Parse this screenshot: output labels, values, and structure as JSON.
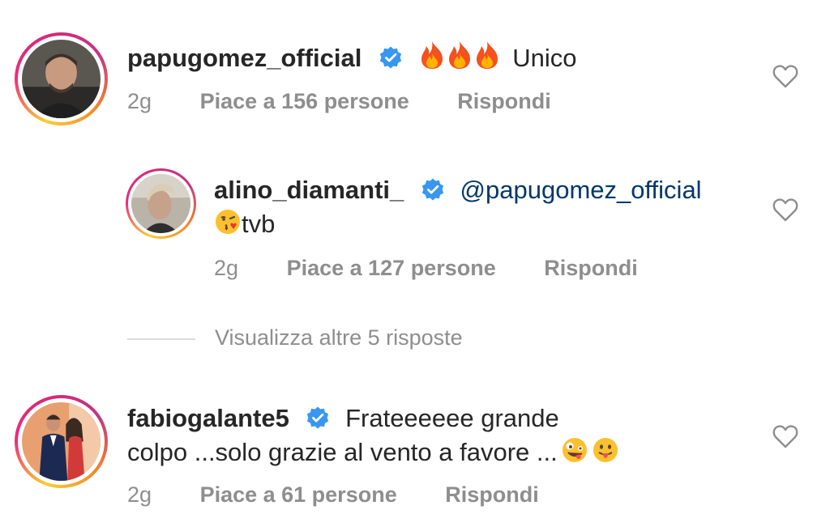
{
  "comments": [
    {
      "username": "papugomez_official",
      "text": "Unico",
      "time": "2g",
      "likes": "Piace a 156 persone",
      "reply": "Rispondi"
    },
    {
      "username": "alino_diamanti_",
      "mention": "@papugomez_official",
      "text": "tvb",
      "time": "2g",
      "likes": "Piace a 127 persone",
      "reply": "Rispondi"
    },
    {
      "username": "fabiogalante5",
      "text_line1": "Frateeeeee grande",
      "text_line2": "colpo ...solo grazie al vento a favore ...",
      "time": "2g",
      "likes": "Piace a 61 persone",
      "reply": "Rispondi"
    }
  ],
  "view_more": "Visualizza altre 5 risposte",
  "colors": {
    "verified": "#3897f0",
    "mention": "#00376b",
    "secondary": "#8e8e8e"
  }
}
